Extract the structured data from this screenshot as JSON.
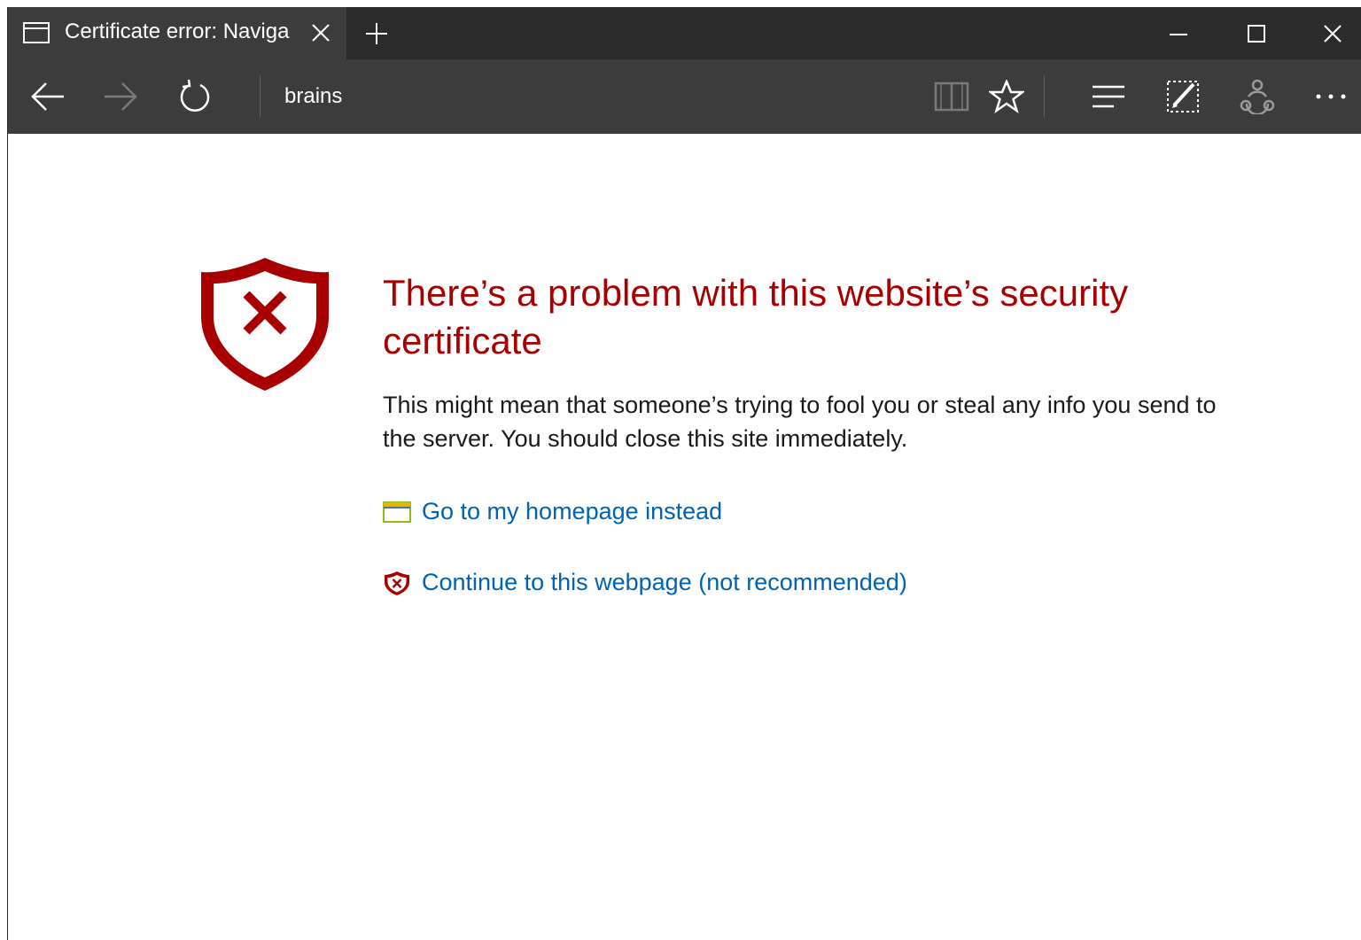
{
  "tab": {
    "title": "Certificate error: Naviga",
    "icon": "tab-page-icon"
  },
  "window_controls": [
    "minimize-icon",
    "maximize-icon",
    "close-icon"
  ],
  "toolbar": {
    "address": "brains",
    "icons": [
      "back-arrow-icon",
      "forward-arrow-icon",
      "refresh-icon",
      "reading-view-icon",
      "favorites-star-icon",
      "hub-icon",
      "web-note-icon",
      "share-icon",
      "more-icon"
    ]
  },
  "error_page": {
    "heading": "There’s a problem with this website’s security certificate",
    "description": "This might mean that someone’s trying to fool you or steal any info you send to the server. You should close this site immediately.",
    "links": [
      {
        "label": "Go to my homepage instead",
        "icon": "homepage-icon"
      },
      {
        "label": "Continue to this webpage (not recommended)",
        "icon": "warning-shield-icon"
      }
    ]
  },
  "colors": {
    "chrome_dark": "#2b2b2b",
    "chrome": "#3c3c3c",
    "error_red": "#a80000",
    "link_blue": "#0063b1",
    "text": "#1a1a1a"
  }
}
